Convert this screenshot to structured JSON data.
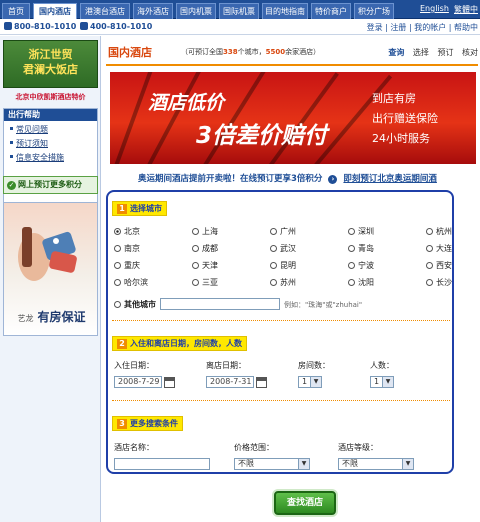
{
  "nav": {
    "tabs": [
      "首页",
      "国内酒店",
      "港澳台酒店",
      "海外酒店",
      "国内机票",
      "国际机票",
      "目的地指南",
      "特价商户",
      "积分广场"
    ],
    "active_index": 1,
    "links": [
      "English",
      "繁體中"
    ]
  },
  "phones": {
    "main": "800-810-1010",
    "second": "400-810-1010"
  },
  "top_links": "登录 | 注册 | 我的帐户 | 帮助中",
  "sidebar": {
    "promo_title_1": "浙江世贸",
    "promo_title_2": "君澜大饭店",
    "promo_caption": "北京中欣凯斯酒店特价",
    "help_title": "出行帮助",
    "help_items": [
      "常见问题",
      "预订须知",
      "信息安全措施"
    ],
    "points_banner": "网上预订更多积分",
    "guarantee_brand": "艺龙",
    "guarantee_text": "有房保证"
  },
  "header": {
    "title": "国内酒店",
    "subtitle_prefix": "（可预订全国",
    "city_count": "338",
    "subtitle_mid": "个城市，",
    "hotel_count": "5500",
    "subtitle_suffix": "余家酒店）",
    "steps": [
      "查询",
      "选择",
      "预订",
      "核对"
    ]
  },
  "banner": {
    "line1": "酒店低价",
    "line2": "3倍差价赔付",
    "side": [
      "到店有房",
      "出行赠送保险",
      "24小时服务"
    ]
  },
  "promo_line": {
    "text": "奥运期间酒店提前开卖啦！在线预订更享3倍积分",
    "link": "即刻预订北京奥运期间酒"
  },
  "form": {
    "section1": {
      "num": "1",
      "title": "选择城市"
    },
    "cities": [
      "北京",
      "上海",
      "广州",
      "深圳",
      "杭州",
      "南京",
      "成都",
      "武汉",
      "青岛",
      "大连",
      "重庆",
      "天津",
      "昆明",
      "宁波",
      "西安",
      "哈尔滨",
      "三亚",
      "苏州",
      "沈阳",
      "长沙"
    ],
    "selected_city": "北京",
    "other_city_label": "其他城市",
    "other_city_hint": "例如：\"珠海\"或\"zhuhai\"",
    "section2": {
      "num": "2",
      "title": "入住和离店日期，房间数，人数"
    },
    "checkin_label": "入住日期：",
    "checkin_value": "2008-7-29",
    "checkout_label": "离店日期：",
    "checkout_value": "2008-7-31",
    "rooms_label": "房间数：",
    "rooms_value": "1",
    "people_label": "人数：",
    "people_value": "1",
    "section3": {
      "num": "3",
      "title": "更多搜索条件"
    },
    "hotel_name_label": "酒店名称：",
    "price_label": "价格范围：",
    "price_value": "不限",
    "star_label": "酒店等级：",
    "star_value": "不限"
  },
  "submit_label": "查找酒店"
}
